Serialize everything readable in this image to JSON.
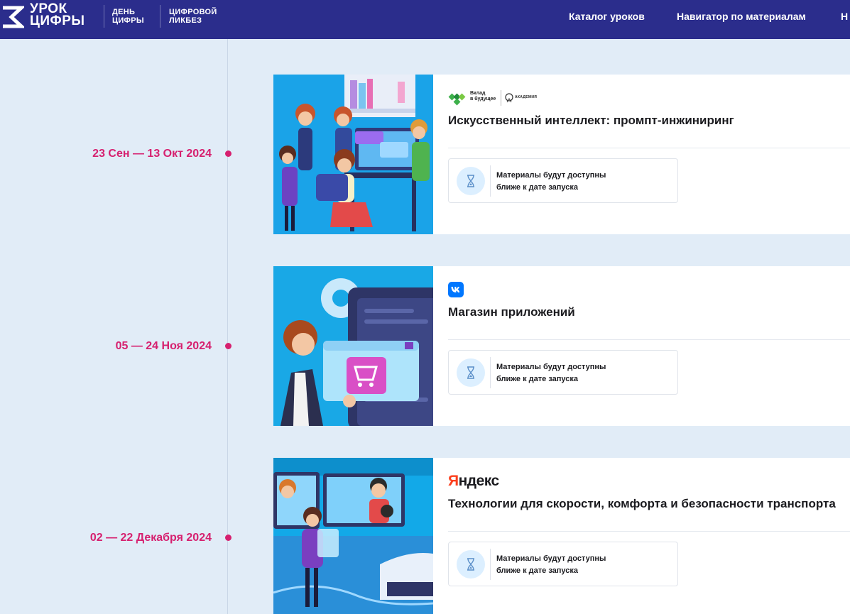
{
  "header": {
    "logo_line1": "УРОК",
    "logo_line2": "ЦИФРЫ",
    "sub1_line1": "ДЕНЬ",
    "sub1_line2": "ЦИФРЫ",
    "sub2_line1": "ЦИФРОВОЙ",
    "sub2_line2": "ЛИКБЕЗ",
    "nav": [
      "Каталог уроков",
      "Навигатор по материалам",
      "Н"
    ]
  },
  "colors": {
    "header_bg": "#2b2d8c",
    "accent_date": "#d6206f",
    "page_bg": "#e1ecf7"
  },
  "lessons": [
    {
      "date": "23 Сен — 13 Окт 2024",
      "partner_line1": "Вклад",
      "partner_line2": "в будущее",
      "partner_badge": "АКАДЕМИЯ",
      "title": "Искусственный интеллект: промпт-инжиниринг",
      "status_line1": "Материалы будут доступны",
      "status_line2": "ближе к дате запуска"
    },
    {
      "date": "05 — 24 Ноя 2024",
      "partner_icon": "vk-logo-icon",
      "title": "Магазин приложений",
      "status_line1": "Материалы будут доступны",
      "status_line2": "ближе к дате запуска"
    },
    {
      "date": "02 — 22 Декабря 2024",
      "partner_brand_first": "Я",
      "partner_brand_rest": "ндекс",
      "title": "Технологии для скорости, комфорта и безопасности транспорта",
      "status_line1": "Материалы будут доступны",
      "status_line2": "ближе к дате запуска"
    }
  ]
}
